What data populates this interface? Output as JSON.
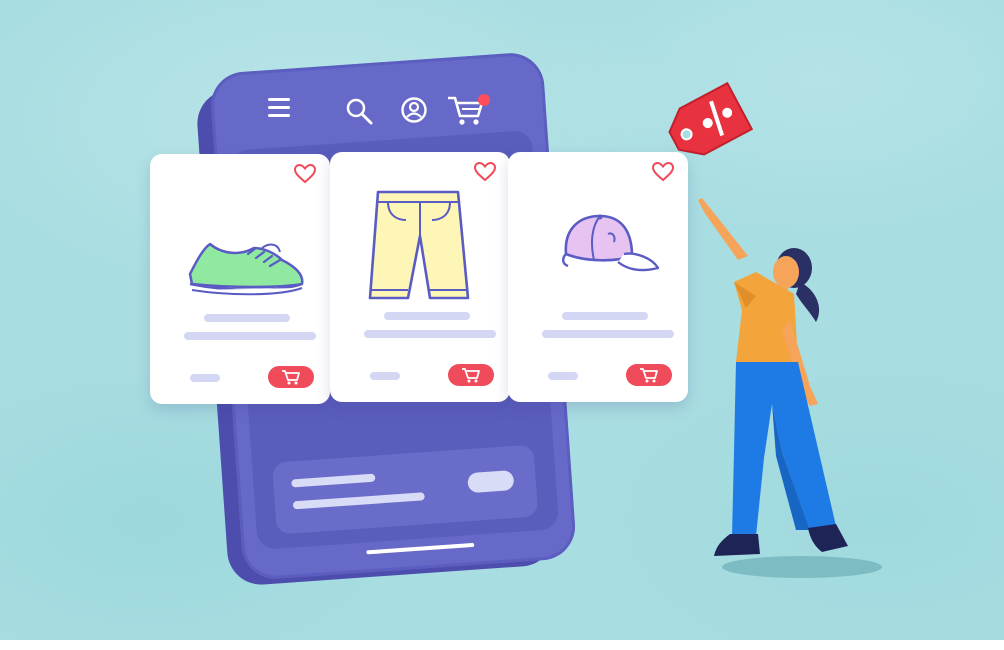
{
  "scene": {
    "background_color": "#a8dde1",
    "accent_color": "#6769c9",
    "sale_color": "#e8323f"
  },
  "phone": {
    "icons": [
      "menu-icon",
      "search-icon",
      "user-icon",
      "cart-icon"
    ],
    "cart_notification": true
  },
  "products": [
    {
      "name": "sneaker",
      "icon": "sneaker-icon",
      "favorite_icon": "heart-icon",
      "action_icon": "cart-icon"
    },
    {
      "name": "shorts",
      "icon": "shorts-icon",
      "favorite_icon": "heart-icon",
      "action_icon": "cart-icon"
    },
    {
      "name": "cap",
      "icon": "cap-icon",
      "favorite_icon": "heart-icon",
      "action_icon": "cart-icon"
    }
  ],
  "discount_tag": {
    "symbol": "%"
  },
  "person": {
    "description_icon": "woman-pointing-illustration"
  }
}
